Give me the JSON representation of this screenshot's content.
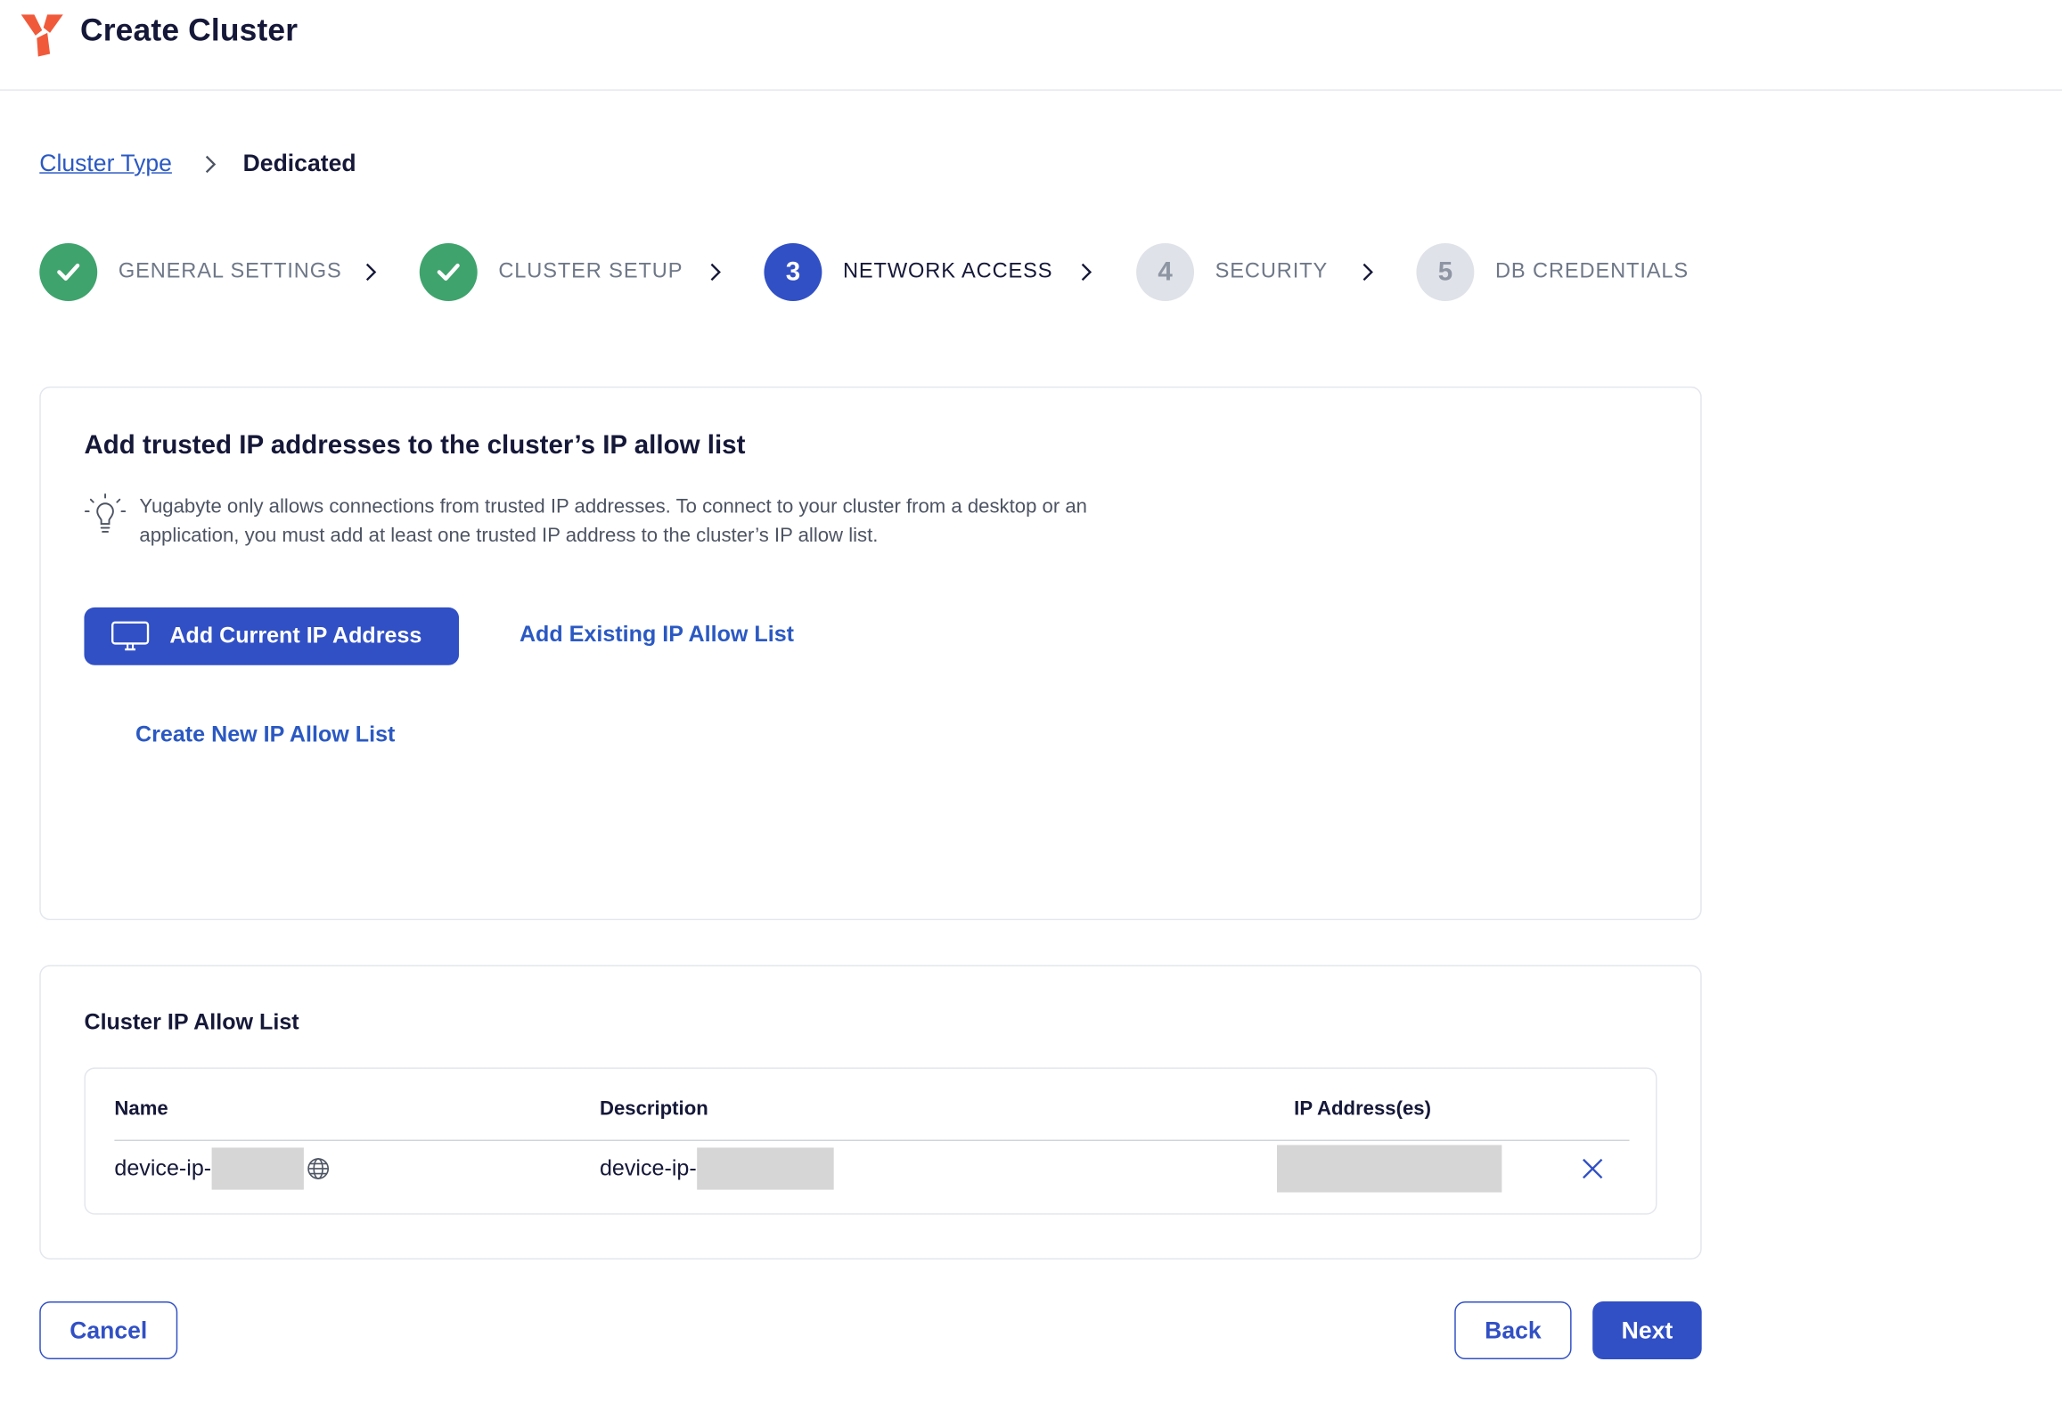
{
  "header": {
    "title": "Create Cluster",
    "logo_icon": "yugabyte-logo-icon",
    "accent_color": "#f05a3a"
  },
  "breadcrumb": {
    "parent": "Cluster Type",
    "current": "Dedicated"
  },
  "stepper": {
    "steps": [
      {
        "number": "1",
        "label": "General Settings",
        "state": "done"
      },
      {
        "number": "2",
        "label": "Cluster Setup",
        "state": "done"
      },
      {
        "number": "3",
        "label": "Network Access",
        "state": "active"
      },
      {
        "number": "4",
        "label": "Security",
        "state": "pending"
      },
      {
        "number": "5",
        "label": "DB Credentials",
        "state": "pending"
      }
    ],
    "done_color": "#3fa36d",
    "active_color": "#3150c5"
  },
  "ip_card": {
    "title": "Add trusted IP addresses to the cluster’s IP allow list",
    "hint": "Yugabyte only allows connections from trusted IP addresses. To connect to your cluster from a desktop or an application, you must add at least one trusted IP address to the cluster’s IP allow list.",
    "add_current_label": "Add Current IP Address",
    "add_existing_label": "Add Existing IP Allow List",
    "create_new_label": "Create New IP Allow List"
  },
  "allow_list": {
    "title": "Cluster IP Allow List",
    "columns": {
      "name": "Name",
      "description": "Description",
      "ip": "IP Address(es)"
    },
    "rows": [
      {
        "name": "device-ip-",
        "description": "device-ip-"
      }
    ]
  },
  "footer": {
    "cancel_label": "Cancel",
    "back_label": "Back",
    "next_label": "Next"
  }
}
